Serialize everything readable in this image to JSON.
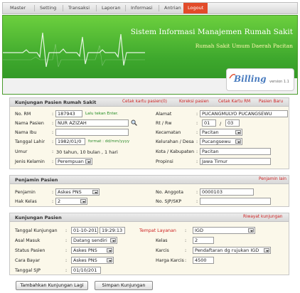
{
  "nav": {
    "items": [
      "Master",
      "Setting",
      "Transaksi",
      "Laporan",
      "Informasi",
      "Antrian",
      "Logout"
    ]
  },
  "banner": {
    "title": "Sistem Informasi Manajemen Rumah Sakit",
    "subtitle": "Rumah Sakit Umum Daerah Pacitan",
    "logo": "Billing",
    "version": "version 1.1"
  },
  "kunjungan_pasien_rs": {
    "title": "Kunjungan Pasien Rumah Sakit",
    "links": [
      "Cetak kartu pasien(0)",
      "Koreksi pasien",
      "Cetak Kartu RM",
      "Pasien Baru"
    ],
    "no_rm_label": "No. RM",
    "no_rm_value": "187943",
    "no_rm_hint": "Lalu tekan Enter.",
    "nama_pasien_label": "Nama Pasien",
    "nama_pasien_value": "NUR AZIZAH",
    "nama_ibu_label": "Nama Ibu",
    "nama_ibu_value": "",
    "tgl_lahir_label": "Tanggal Lahir",
    "tgl_lahir_value": "1982/01/0",
    "tgl_lahir_hint": "format : dd/mm/yyyy",
    "umur_label": "Umur",
    "umur_value": "30 tahun, 10 bulan , 1 hari",
    "jk_label": "Jenis Kelamin",
    "jk_value": "Perempuan",
    "alamat_label": "Alamat",
    "alamat_value": "PUCANGMULYO PUCANGSEWU",
    "rtrw_label": "Rt / Rw",
    "rt_value": "01",
    "rw_value": "03",
    "kecamatan_label": "Kecamatan",
    "kecamatan_value": "Pacitan",
    "kelurahan_label": "Kelurahan / Desa",
    "kelurahan_value": "Pucangsewu",
    "kota_label": "Kota / Kabupaten",
    "kota_value": "Pacitan",
    "propinsi_label": "Propinsi",
    "propinsi_value": "Jawa Timur"
  },
  "penjamin": {
    "title": "Penjamin Pasien",
    "link": "Penjamin lain",
    "penjamin_label": "Penjamin",
    "penjamin_value": "Askes PNS",
    "hak_kelas_label": "Hak Kelas",
    "hak_kelas_value": "2",
    "no_anggota_label": "No. Anggota",
    "no_anggota_value": "0000103",
    "no_sjp_label": "No. SJP/SKP",
    "no_sjp_value": ""
  },
  "kunjungan": {
    "title": "Kunjungan Pasien",
    "link": "Riwayat kunjungan",
    "tgl_kunjungan_label": "Tanggal Kunjungan",
    "tgl_kunjungan_date": "01-10-201",
    "tgl_kunjungan_time": "19:29:13",
    "asal_masuk_label": "Asal Masuk",
    "asal_masuk_value": "Datang sendiri",
    "status_pasien_label": "Status Pasien",
    "status_pasien_value": "Askes PNS",
    "cara_bayar_label": "Cara Bayar",
    "cara_bayar_value": "Askes PNS",
    "tgl_sjp_label": "Tanggal SJP",
    "tgl_sjp_value": "01/10/201",
    "tempat_layanan_label": "Tempat Layanan",
    "tempat_layanan_value": "IGD",
    "kelas_label": "Kelas",
    "kelas_value": "2",
    "karcis_label": "Karcis",
    "karcis_value": "Pendaftaran dg rujukan IGD",
    "harga_karcis_label": "Harga Karcis",
    "harga_karcis_value": "4500"
  },
  "buttons": {
    "tambah": "Tambahkan Kunjungan Lagi",
    "simpan": "Simpan Kunjungan"
  },
  "colors": {
    "brand_green": "#3ea82d",
    "accent_red": "#cc1f1f",
    "nav_active": "#e24b2a",
    "link_blue": "#1a3fa8"
  }
}
